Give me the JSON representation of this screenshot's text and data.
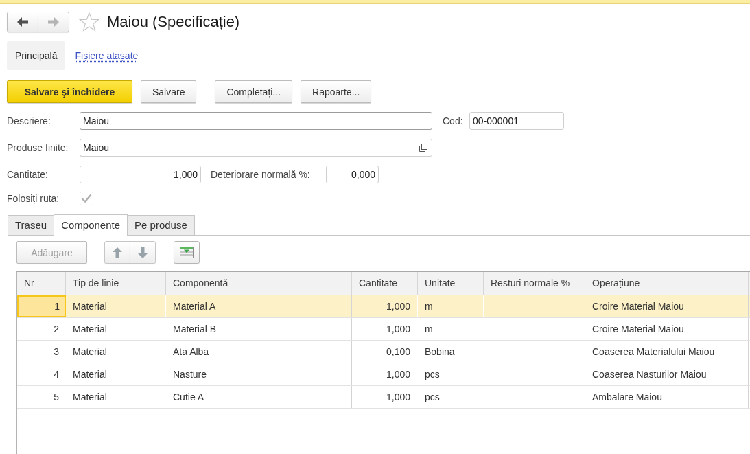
{
  "window": {
    "title": "Maiou (Specificație)",
    "favorite": false
  },
  "navigation": [
    {
      "kind": "back",
      "disabled": false
    },
    {
      "kind": "forward",
      "disabled": true
    }
  ],
  "sections": [
    {
      "label": "Principală",
      "selected": true
    },
    {
      "label": "Fișiere atașate",
      "selected": false
    }
  ],
  "command_groups": [
    {
      "buttons": [
        {
          "label": "Salvare şi închidere",
          "kind": "primary"
        },
        {
          "label": "Salvare",
          "kind": "default"
        }
      ]
    },
    {
      "buttons": [
        {
          "label": "Completați...",
          "kind": "default"
        },
        {
          "label": "Rapoarte...",
          "kind": "default"
        }
      ]
    }
  ],
  "form": {
    "description": {
      "label": "Descriere:",
      "value": "Maiou",
      "focused": true
    },
    "code": {
      "label": "Cod:",
      "value": "00-000001",
      "focused": false
    },
    "finished_products": {
      "label": "Produse finite:",
      "value": "Maiou",
      "focused": false
    },
    "quantity": {
      "label": "Cantitate:",
      "value": "1,000",
      "focused": false
    },
    "normal_spoilage": {
      "label": "Deteriorare normală %:",
      "value": "0,000",
      "focused": false
    },
    "use_route": {
      "label": "Folosiți ruta:",
      "checked": true,
      "disabled": true
    }
  },
  "tabs": [
    {
      "label": "Traseu",
      "selected": false
    },
    {
      "label": "Componente",
      "selected": true
    },
    {
      "label": "Pe produse",
      "selected": false
    }
  ],
  "toolbar": {
    "add": {
      "label": "Adăugare",
      "disabled": true
    }
  },
  "table": {
    "columns": [
      "Nr",
      "Tip de linie",
      "Componentă",
      "Cantitate",
      "Unitate",
      "Resturi normale %",
      "Operațiune"
    ],
    "rows": [
      {
        "nr": "1",
        "line_type": "Material",
        "component": "Material A",
        "quantity": "1,000",
        "unit": "m",
        "operation": "Croire Material Maiou",
        "selected": true
      },
      {
        "nr": "2",
        "line_type": "Material",
        "component": "Material B",
        "quantity": "1,000",
        "unit": "m",
        "operation": "Croire Material Maiou",
        "selected": false
      },
      {
        "nr": "3",
        "line_type": "Material",
        "component": "Ata Alba",
        "quantity": "0,100",
        "unit": "Bobina",
        "operation": "Coaserea Materialului Maiou",
        "selected": false
      },
      {
        "nr": "4",
        "line_type": "Material",
        "component": "Nasture",
        "quantity": "1,000",
        "unit": "pcs",
        "operation": "Coaserea Nasturilor Maiou",
        "selected": false
      },
      {
        "nr": "5",
        "line_type": "Material",
        "component": "Cutie A",
        "quantity": "1,000",
        "unit": "pcs",
        "operation": "Ambalare Maiou",
        "selected": false
      }
    ]
  }
}
